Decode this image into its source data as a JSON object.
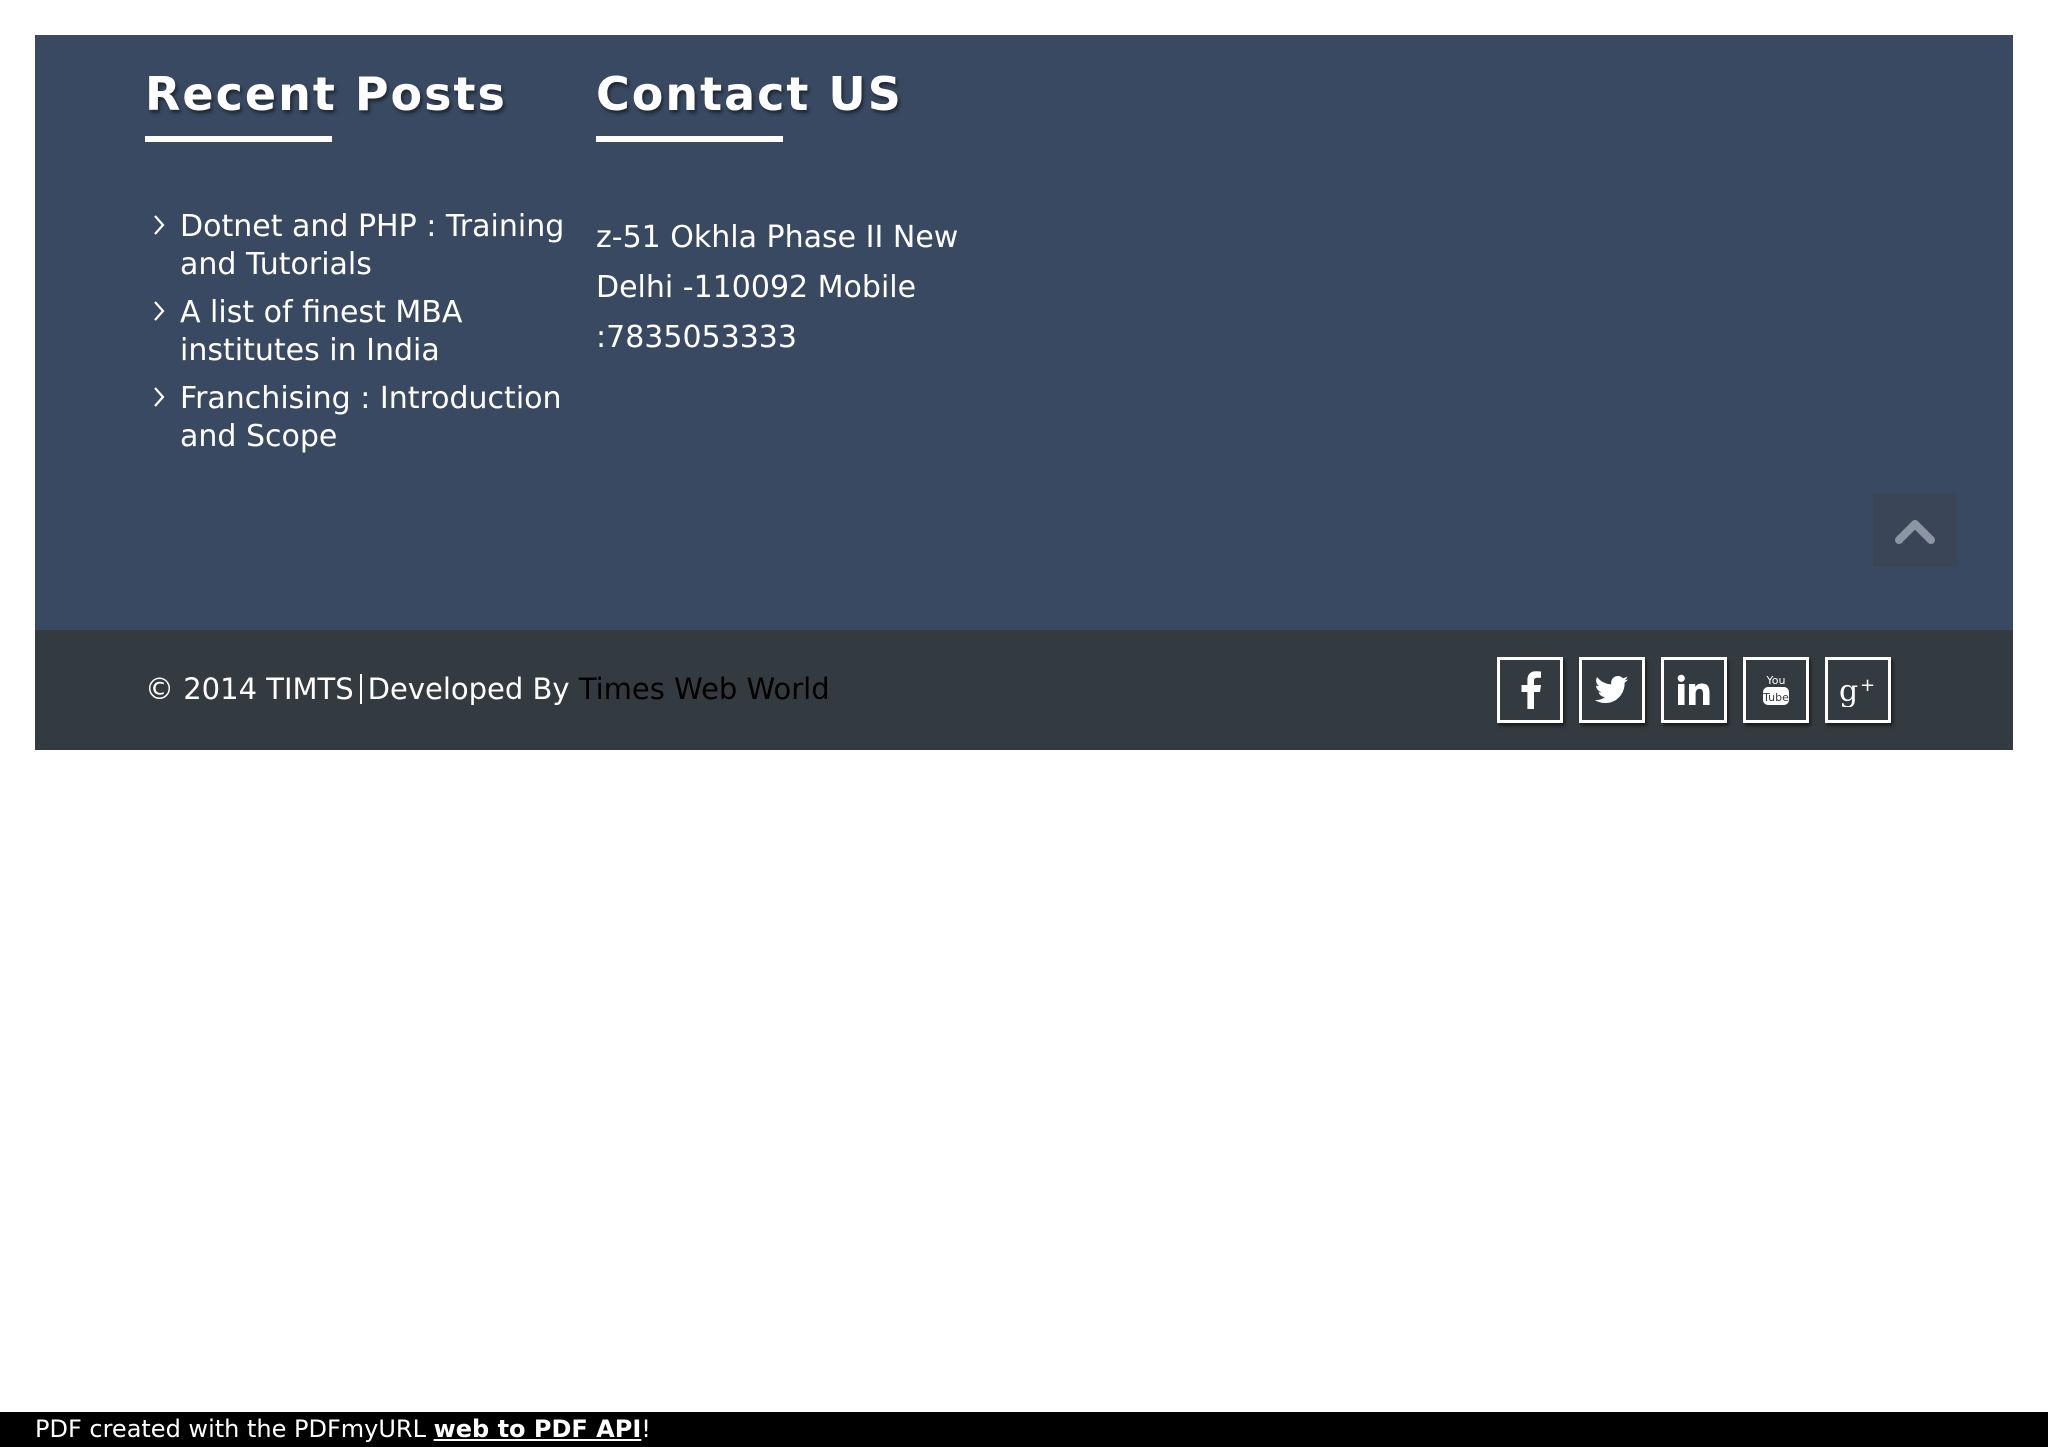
{
  "recent_posts": {
    "title": "Recent Posts",
    "items": [
      {
        "label": "Dotnet and PHP : Training and Tutorials",
        "icon": "chevron-right-icon"
      },
      {
        "label": "A list of finest MBA institutes in India",
        "icon": "chevron-right-icon"
      },
      {
        "label": "Franchising : Introduction and Scope",
        "icon": "chevron-right-icon"
      }
    ]
  },
  "contact": {
    "title": "Contact US",
    "address": "z-51 Okhla Phase II New Delhi -110092 Mobile :7835053333"
  },
  "scroll_top": {
    "icon": "chevron-up-icon"
  },
  "bottom_bar": {
    "copyright": "© 2014 TIMTS",
    "developed_by": "Developed By",
    "developer_link": "Times Web World",
    "social": [
      {
        "name": "facebook",
        "icon": "facebook-icon"
      },
      {
        "name": "twitter",
        "icon": "twitter-icon"
      },
      {
        "name": "linkedin",
        "icon": "linkedin-icon"
      },
      {
        "name": "youtube",
        "icon": "youtube-icon"
      },
      {
        "name": "google-plus",
        "icon": "google-plus-icon"
      }
    ]
  },
  "pdf_bar": {
    "prefix": "PDF created with the PDFmyURL",
    "link": "web to PDF API",
    "suffix": "!"
  },
  "colors": {
    "footer_top_bg": "#384961",
    "footer_bottom_bg": "#343b40",
    "scroll_top_bg": "#3a4657",
    "pdf_bar_bg": "#000000",
    "text": "#ffffff"
  }
}
